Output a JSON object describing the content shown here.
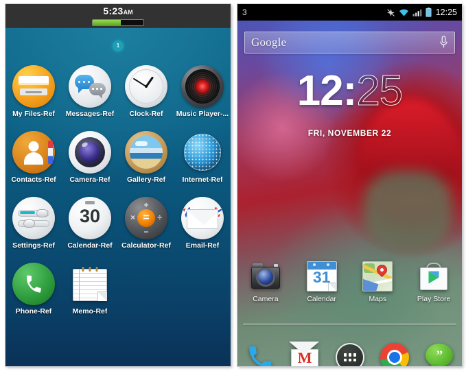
{
  "left_phone": {
    "status_bar": {
      "time": "5:23",
      "ampm": "AM",
      "battery_icon": "battery-bar-icon",
      "battery_level_percent": 55
    },
    "page_indicator": {
      "label": "1",
      "name": "page-indicator-badge"
    },
    "apps": [
      [
        {
          "label": "My Files-Ref",
          "icon": "my-files-icon"
        },
        {
          "label": "Messages-Ref",
          "icon": "messages-icon"
        },
        {
          "label": "Clock-Ref",
          "icon": "clock-icon"
        },
        {
          "label": "Music Player-...",
          "icon": "music-player-icon"
        }
      ],
      [
        {
          "label": "Contacts-Ref",
          "icon": "contacts-icon"
        },
        {
          "label": "Camera-Ref",
          "icon": "camera-icon"
        },
        {
          "label": "Gallery-Ref",
          "icon": "gallery-icon"
        },
        {
          "label": "Internet-Ref",
          "icon": "internet-icon"
        }
      ],
      [
        {
          "label": "Settings-Ref",
          "icon": "settings-icon"
        },
        {
          "label": "Calendar-Ref",
          "icon": "calendar-icon",
          "badge": "30"
        },
        {
          "label": "Calculator-Ref",
          "icon": "calculator-icon",
          "badge": "="
        },
        {
          "label": "Email-Ref",
          "icon": "email-icon"
        }
      ],
      [
        {
          "label": "Phone-Ref",
          "icon": "phone-icon"
        },
        {
          "label": "Memo-Ref",
          "icon": "memo-icon"
        },
        {
          "label": "",
          "icon": ""
        },
        {
          "label": "",
          "icon": ""
        }
      ]
    ],
    "colors": {
      "status_bar": "#323232",
      "wallpaper_top": "#10688c",
      "wallpaper_bottom": "#0b3157"
    }
  },
  "right_phone": {
    "status_bar": {
      "left_text": "3",
      "icons": [
        "gps-off-icon",
        "wifi-icon",
        "signal-bars-icon",
        "battery-icon"
      ],
      "time": "12:25"
    },
    "search_widget": {
      "label": "Google",
      "placeholder": "Google",
      "mic_icon": "microphone-icon"
    },
    "clock_widget": {
      "hours": "12",
      "separator": ":",
      "minutes": "25",
      "date": "FRI, NOVEMBER 22"
    },
    "home_apps": [
      {
        "label": "Camera",
        "icon": "camera-icon"
      },
      {
        "label": "Calendar",
        "icon": "calendar-icon",
        "badge": "31"
      },
      {
        "label": "Maps",
        "icon": "maps-icon"
      },
      {
        "label": "Play Store",
        "icon": "play-store-icon"
      }
    ],
    "dock": [
      {
        "label": "Phone",
        "icon": "phone-dialer-icon"
      },
      {
        "label": "Gmail",
        "icon": "gmail-icon",
        "glyph": "M"
      },
      {
        "label": "Apps",
        "icon": "app-drawer-icon"
      },
      {
        "label": "Chrome",
        "icon": "chrome-icon"
      },
      {
        "label": "Hangouts",
        "icon": "hangouts-icon",
        "glyph": "”"
      }
    ],
    "colors": {
      "status_bar": "#000000",
      "accent_red": "#c71d2a",
      "accent_green": "#6f8a76"
    }
  }
}
